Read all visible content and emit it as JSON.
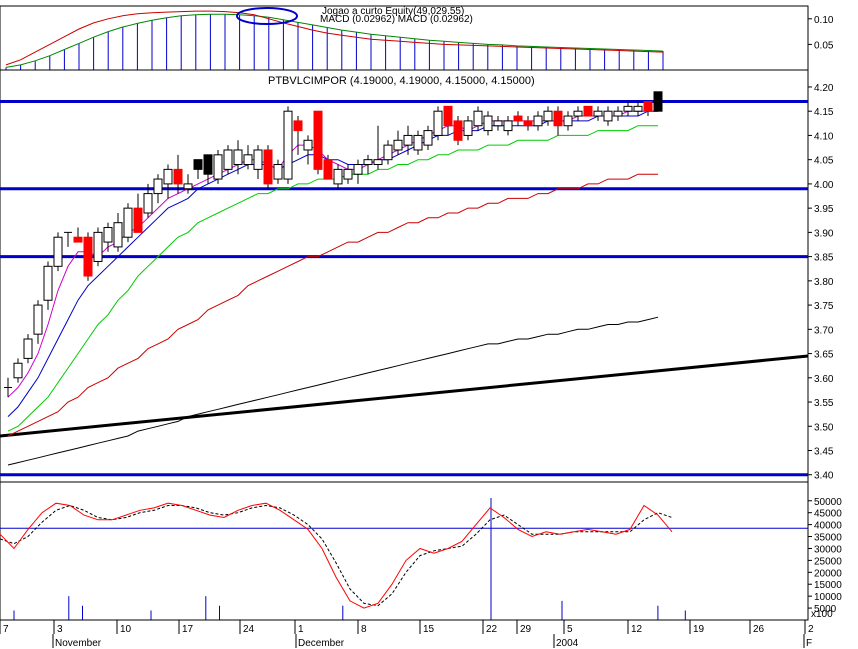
{
  "colors": {
    "background": "#ffffff",
    "frame": "#000000",
    "support_lines": "#0000cc",
    "bull_candle_fill": "#ffffff",
    "bear_candle_fill": "#ff0000",
    "black_candle_fill": "#000000",
    "ma_magenta": "#cc00cc",
    "ma_blue": "#0000cc",
    "ma_green": "#00cc00",
    "ma_red": "#cc0000",
    "ma_black": "#000000",
    "macd_red": "#cc0000",
    "macd_green": "#008800",
    "macd_hist": "#0000cc",
    "stoch_red": "#ff0000",
    "stoch_dash": "#000000",
    "volume": "#0000cc",
    "ellipse": "#0000cc"
  },
  "chart_data": [
    {
      "type": "bar",
      "panel": "macd",
      "title": "MACD (0.02962) MACD (0.02962)",
      "overlay_title": "Jogao a curto Equity(49,029.55)",
      "ylim": [
        0.0,
        0.125
      ],
      "yticks": [
        "0.10",
        "0.05"
      ],
      "ytick_values": [
        0.1,
        0.05
      ],
      "line_red": [
        0.01,
        0.02,
        0.035,
        0.05,
        0.065,
        0.08,
        0.092,
        0.1,
        0.106,
        0.11,
        0.112,
        0.113,
        0.114,
        0.115,
        0.115,
        0.114,
        0.112,
        0.108,
        0.1,
        0.092,
        0.085,
        0.078,
        0.072,
        0.068,
        0.064,
        0.06,
        0.058,
        0.056,
        0.054,
        0.052,
        0.05,
        0.049,
        0.048,
        0.047,
        0.046,
        0.045,
        0.044,
        0.043,
        0.042,
        0.041,
        0.04,
        0.039,
        0.038,
        0.037,
        0.036,
        0.035
      ],
      "line_green": [
        0.005,
        0.01,
        0.018,
        0.028,
        0.04,
        0.052,
        0.064,
        0.075,
        0.084,
        0.091,
        0.097,
        0.102,
        0.106,
        0.108,
        0.109,
        0.109,
        0.108,
        0.106,
        0.103,
        0.098,
        0.093,
        0.088,
        0.083,
        0.078,
        0.074,
        0.07,
        0.067,
        0.064,
        0.061,
        0.058,
        0.056,
        0.054,
        0.052,
        0.05,
        0.049,
        0.047,
        0.046,
        0.045,
        0.044,
        0.043,
        0.042,
        0.041,
        0.04,
        0.039,
        0.038,
        0.037
      ],
      "histogram": [
        0.005,
        0.01,
        0.018,
        0.028,
        0.04,
        0.052,
        0.064,
        0.075,
        0.084,
        0.091,
        0.097,
        0.102,
        0.106,
        0.108,
        0.109,
        0.109,
        0.108,
        0.106,
        0.103,
        0.098,
        0.093,
        0.088,
        0.083,
        0.078,
        0.074,
        0.07,
        0.067,
        0.064,
        0.061,
        0.058,
        0.056,
        0.054,
        0.052,
        0.05,
        0.049,
        0.047,
        0.046,
        0.045,
        0.044,
        0.043,
        0.042,
        0.041,
        0.04,
        0.039,
        0.038,
        0.037
      ]
    },
    {
      "type": "candlestick",
      "panel": "price",
      "title": "PTBVLCIMPOR (4.19000, 4.19000, 4.15000, 4.15000)",
      "ylim": [
        3.385,
        4.235
      ],
      "yticks": [
        "4.20",
        "4.15",
        "4.10",
        "4.05",
        "4.00",
        "3.95",
        "3.90",
        "3.85",
        "3.80",
        "3.75",
        "3.70",
        "3.65",
        "3.60",
        "3.55",
        "3.50",
        "3.45",
        "3.40"
      ],
      "ytick_values": [
        4.2,
        4.15,
        4.1,
        4.05,
        4.0,
        3.95,
        3.9,
        3.85,
        3.8,
        3.75,
        3.7,
        3.65,
        3.6,
        3.55,
        3.5,
        3.45,
        3.4
      ],
      "support_levels": [
        4.17,
        3.99,
        3.85,
        3.4
      ],
      "trendline": {
        "start": 3.48,
        "end": 3.645
      },
      "candles": [
        {
          "o": 3.58,
          "h": 3.6,
          "l": 3.56,
          "c": 3.58,
          "k": "cross"
        },
        {
          "o": 3.6,
          "h": 3.64,
          "l": 3.59,
          "c": 3.63,
          "k": "up"
        },
        {
          "o": 3.64,
          "h": 3.69,
          "l": 3.63,
          "c": 3.68,
          "k": "up"
        },
        {
          "o": 3.69,
          "h": 3.76,
          "l": 3.67,
          "c": 3.75,
          "k": "up"
        },
        {
          "o": 3.76,
          "h": 3.84,
          "l": 3.74,
          "c": 3.83,
          "k": "up"
        },
        {
          "o": 3.83,
          "h": 3.9,
          "l": 3.82,
          "c": 3.89,
          "k": "up"
        },
        {
          "o": 3.9,
          "h": 3.9,
          "l": 3.87,
          "c": 3.9,
          "k": "cross"
        },
        {
          "o": 3.89,
          "h": 3.91,
          "l": 3.88,
          "c": 3.88,
          "k": "down"
        },
        {
          "o": 3.89,
          "h": 3.9,
          "l": 3.8,
          "c": 3.81,
          "k": "down"
        },
        {
          "o": 3.84,
          "h": 3.91,
          "l": 3.83,
          "c": 3.9,
          "k": "up"
        },
        {
          "o": 3.88,
          "h": 3.92,
          "l": 3.86,
          "c": 3.91,
          "k": "up"
        },
        {
          "o": 3.87,
          "h": 3.94,
          "l": 3.86,
          "c": 3.92,
          "k": "up"
        },
        {
          "o": 3.89,
          "h": 3.96,
          "l": 3.88,
          "c": 3.95,
          "k": "up"
        },
        {
          "o": 3.95,
          "h": 3.98,
          "l": 3.9,
          "c": 3.9,
          "k": "down"
        },
        {
          "o": 3.94,
          "h": 4.0,
          "l": 3.93,
          "c": 3.98,
          "k": "up"
        },
        {
          "o": 3.98,
          "h": 4.02,
          "l": 3.96,
          "c": 4.01,
          "k": "up"
        },
        {
          "o": 4.0,
          "h": 4.04,
          "l": 3.97,
          "c": 4.03,
          "k": "up"
        },
        {
          "o": 4.03,
          "h": 4.06,
          "l": 3.98,
          "c": 4.0,
          "k": "down"
        },
        {
          "o": 3.99,
          "h": 4.02,
          "l": 3.98,
          "c": 4.0,
          "k": "up"
        },
        {
          "o": 4.03,
          "h": 4.05,
          "l": 4.01,
          "c": 4.05,
          "k": "black"
        },
        {
          "o": 4.02,
          "h": 4.06,
          "l": 4.0,
          "c": 4.06,
          "k": "black"
        },
        {
          "o": 4.01,
          "h": 4.07,
          "l": 4.0,
          "c": 4.06,
          "k": "up"
        },
        {
          "o": 4.03,
          "h": 4.08,
          "l": 4.02,
          "c": 4.07,
          "k": "up"
        },
        {
          "o": 4.04,
          "h": 4.09,
          "l": 4.02,
          "c": 4.07,
          "k": "up"
        },
        {
          "o": 4.04,
          "h": 4.08,
          "l": 4.03,
          "c": 4.06,
          "k": "up"
        },
        {
          "o": 4.03,
          "h": 4.08,
          "l": 4.01,
          "c": 4.07,
          "k": "up"
        },
        {
          "o": 4.07,
          "h": 4.08,
          "l": 3.99,
          "c": 4.0,
          "k": "down"
        },
        {
          "o": 4.01,
          "h": 4.05,
          "l": 4.0,
          "c": 4.04,
          "k": "up"
        },
        {
          "o": 4.01,
          "h": 4.16,
          "l": 4.0,
          "c": 4.15,
          "k": "up"
        },
        {
          "o": 4.13,
          "h": 4.14,
          "l": 4.06,
          "c": 4.11,
          "k": "down"
        },
        {
          "o": 4.09,
          "h": 4.1,
          "l": 4.04,
          "c": 4.07,
          "k": "up"
        },
        {
          "o": 4.15,
          "h": 4.15,
          "l": 4.02,
          "c": 4.03,
          "k": "down"
        },
        {
          "o": 4.05,
          "h": 4.06,
          "l": 4.01,
          "c": 4.01,
          "k": "down"
        },
        {
          "o": 4.0,
          "h": 4.04,
          "l": 3.99,
          "c": 4.03,
          "k": "up"
        },
        {
          "o": 4.01,
          "h": 4.04,
          "l": 4.0,
          "c": 4.03,
          "k": "up"
        },
        {
          "o": 4.02,
          "h": 4.05,
          "l": 4.0,
          "c": 4.04,
          "k": "up"
        },
        {
          "o": 4.04,
          "h": 4.06,
          "l": 4.02,
          "c": 4.05,
          "k": "up"
        },
        {
          "o": 4.04,
          "h": 4.12,
          "l": 4.03,
          "c": 4.05,
          "k": "up"
        },
        {
          "o": 4.05,
          "h": 4.09,
          "l": 4.04,
          "c": 4.08,
          "k": "up"
        },
        {
          "o": 4.07,
          "h": 4.11,
          "l": 4.06,
          "c": 4.09,
          "k": "up"
        },
        {
          "o": 4.08,
          "h": 4.12,
          "l": 4.06,
          "c": 4.1,
          "k": "up"
        },
        {
          "o": 4.07,
          "h": 4.11,
          "l": 4.06,
          "c": 4.1,
          "k": "up"
        },
        {
          "o": 4.08,
          "h": 4.12,
          "l": 4.07,
          "c": 4.11,
          "k": "up"
        },
        {
          "o": 4.1,
          "h": 4.16,
          "l": 4.09,
          "c": 4.15,
          "k": "up"
        },
        {
          "o": 4.16,
          "h": 4.16,
          "l": 4.1,
          "c": 4.12,
          "k": "down"
        },
        {
          "o": 4.13,
          "h": 4.14,
          "l": 4.08,
          "c": 4.09,
          "k": "down"
        },
        {
          "o": 4.1,
          "h": 4.14,
          "l": 4.09,
          "c": 4.13,
          "k": "up"
        },
        {
          "o": 4.12,
          "h": 4.16,
          "l": 4.11,
          "c": 4.15,
          "k": "up"
        },
        {
          "o": 4.11,
          "h": 4.15,
          "l": 4.1,
          "c": 4.14,
          "k": "up"
        },
        {
          "o": 4.12,
          "h": 4.14,
          "l": 4.11,
          "c": 4.13,
          "k": "up"
        },
        {
          "o": 4.11,
          "h": 4.14,
          "l": 4.1,
          "c": 4.13,
          "k": "up"
        },
        {
          "o": 4.14,
          "h": 4.15,
          "l": 4.12,
          "c": 4.13,
          "k": "down"
        },
        {
          "o": 4.13,
          "h": 4.14,
          "l": 4.11,
          "c": 4.12,
          "k": "down"
        },
        {
          "o": 4.12,
          "h": 4.15,
          "l": 4.11,
          "c": 4.14,
          "k": "up"
        },
        {
          "o": 4.13,
          "h": 4.16,
          "l": 4.12,
          "c": 4.15,
          "k": "up"
        },
        {
          "o": 4.15,
          "h": 4.16,
          "l": 4.1,
          "c": 4.12,
          "k": "down"
        },
        {
          "o": 4.12,
          "h": 4.15,
          "l": 4.11,
          "c": 4.14,
          "k": "up"
        },
        {
          "o": 4.14,
          "h": 4.16,
          "l": 4.13,
          "c": 4.15,
          "k": "up"
        },
        {
          "o": 4.16,
          "h": 4.16,
          "l": 4.14,
          "c": 4.14,
          "k": "down"
        },
        {
          "o": 4.14,
          "h": 4.16,
          "l": 4.13,
          "c": 4.15,
          "k": "up"
        },
        {
          "o": 4.13,
          "h": 4.16,
          "l": 4.12,
          "c": 4.15,
          "k": "up"
        },
        {
          "o": 4.14,
          "h": 4.16,
          "l": 4.13,
          "c": 4.15,
          "k": "up"
        },
        {
          "o": 4.15,
          "h": 4.17,
          "l": 4.14,
          "c": 4.16,
          "k": "up"
        },
        {
          "o": 4.15,
          "h": 4.17,
          "l": 4.14,
          "c": 4.16,
          "k": "up"
        },
        {
          "o": 4.17,
          "h": 4.17,
          "l": 4.14,
          "c": 4.15,
          "k": "down"
        },
        {
          "o": 4.19,
          "h": 4.19,
          "l": 4.15,
          "c": 4.15,
          "k": "black"
        }
      ],
      "ma_magenta": [
        3.56,
        3.58,
        3.61,
        3.65,
        3.71,
        3.78,
        3.83,
        3.86,
        3.86,
        3.85,
        3.87,
        3.88,
        3.9,
        3.91,
        3.93,
        3.95,
        3.97,
        3.98,
        3.99,
        4.0,
        4.01,
        4.02,
        4.03,
        4.04,
        4.05,
        4.05,
        4.04,
        4.03,
        4.06,
        4.08,
        4.08,
        4.07,
        4.05,
        4.04,
        4.03,
        4.03,
        4.04,
        4.05,
        4.06,
        4.07,
        4.08,
        4.09,
        4.1,
        4.11,
        4.12,
        4.12,
        4.11,
        4.12,
        4.13,
        4.13,
        4.13,
        4.13,
        4.13,
        4.13,
        4.13,
        4.13,
        4.13,
        4.14,
        4.14,
        4.14,
        4.14,
        4.14,
        4.15,
        4.15,
        4.15,
        4.15
      ],
      "ma_blue": [
        3.52,
        3.54,
        3.57,
        3.6,
        3.64,
        3.68,
        3.72,
        3.76,
        3.79,
        3.81,
        3.83,
        3.85,
        3.87,
        3.89,
        3.91,
        3.93,
        3.95,
        3.96,
        3.97,
        3.99,
        4.0,
        4.01,
        4.02,
        4.03,
        4.04,
        4.04,
        4.04,
        4.03,
        4.04,
        4.05,
        4.06,
        4.06,
        4.05,
        4.05,
        4.04,
        4.04,
        4.04,
        4.05,
        4.05,
        4.06,
        4.07,
        4.08,
        4.09,
        4.1,
        4.1,
        4.11,
        4.11,
        4.11,
        4.12,
        4.12,
        4.12,
        4.12,
        4.12,
        4.12,
        4.13,
        4.13,
        4.13,
        4.13,
        4.13,
        4.14,
        4.14,
        4.14,
        4.14,
        4.14,
        4.15,
        4.15
      ],
      "ma_green": [
        3.49,
        3.5,
        3.52,
        3.54,
        3.56,
        3.59,
        3.62,
        3.65,
        3.68,
        3.71,
        3.73,
        3.76,
        3.78,
        3.81,
        3.83,
        3.85,
        3.87,
        3.89,
        3.9,
        3.92,
        3.93,
        3.94,
        3.95,
        3.96,
        3.97,
        3.98,
        3.98,
        3.99,
        3.99,
        4.0,
        4.0,
        4.01,
        4.01,
        4.01,
        4.02,
        4.02,
        4.02,
        4.03,
        4.03,
        4.04,
        4.04,
        4.05,
        4.05,
        4.06,
        4.06,
        4.07,
        4.07,
        4.07,
        4.08,
        4.08,
        4.08,
        4.09,
        4.09,
        4.09,
        4.09,
        4.1,
        4.1,
        4.1,
        4.1,
        4.11,
        4.11,
        4.11,
        4.11,
        4.12,
        4.12,
        4.12
      ],
      "ma_red": [
        3.48,
        3.49,
        3.5,
        3.51,
        3.52,
        3.53,
        3.55,
        3.56,
        3.58,
        3.59,
        3.6,
        3.62,
        3.63,
        3.64,
        3.66,
        3.67,
        3.68,
        3.7,
        3.71,
        3.72,
        3.74,
        3.75,
        3.76,
        3.77,
        3.79,
        3.8,
        3.81,
        3.82,
        3.83,
        3.84,
        3.85,
        3.85,
        3.86,
        3.87,
        3.88,
        3.88,
        3.89,
        3.9,
        3.9,
        3.91,
        3.92,
        3.92,
        3.93,
        3.93,
        3.94,
        3.94,
        3.95,
        3.95,
        3.96,
        3.96,
        3.97,
        3.97,
        3.97,
        3.98,
        3.98,
        3.99,
        3.99,
        3.99,
        4.0,
        4.0,
        4.01,
        4.01,
        4.01,
        4.02,
        4.02,
        4.02
      ],
      "ma_black": [
        3.42,
        3.425,
        3.43,
        3.435,
        3.44,
        3.445,
        3.45,
        3.455,
        3.46,
        3.465,
        3.47,
        3.475,
        3.48,
        3.49,
        3.495,
        3.5,
        3.505,
        3.51,
        3.52,
        3.525,
        3.53,
        3.535,
        3.54,
        3.545,
        3.55,
        3.555,
        3.56,
        3.565,
        3.57,
        3.575,
        3.58,
        3.585,
        3.59,
        3.595,
        3.6,
        3.605,
        3.61,
        3.615,
        3.62,
        3.625,
        3.63,
        3.635,
        3.64,
        3.645,
        3.65,
        3.655,
        3.66,
        3.665,
        3.67,
        3.67,
        3.675,
        3.68,
        3.68,
        3.685,
        3.69,
        3.69,
        3.695,
        3.7,
        3.7,
        3.705,
        3.71,
        3.71,
        3.715,
        3.715,
        3.72,
        3.725
      ]
    },
    {
      "type": "line",
      "panel": "oscillator",
      "ylim": [
        0,
        52000
      ],
      "yticks": [
        "50000",
        "45000",
        "40000",
        "35000",
        "30000",
        "25000",
        "20000",
        "15000",
        "10000",
        "5000"
      ],
      "ytick_values": [
        50000,
        45000,
        40000,
        35000,
        30000,
        25000,
        20000,
        15000,
        10000,
        5000
      ],
      "ylabel_unit": "x100",
      "reference_level": 38500,
      "series_red": [
        36000,
        30000,
        38000,
        45000,
        49000,
        48000,
        44000,
        42000,
        42000,
        44000,
        46000,
        47000,
        49000,
        48000,
        46000,
        44000,
        43000,
        46000,
        48000,
        49000,
        46000,
        42000,
        38000,
        30000,
        18000,
        8000,
        5000,
        7000,
        15000,
        25000,
        30000,
        28000,
        30000,
        33000,
        40000,
        47000,
        43000,
        38000,
        35000,
        37000,
        36000,
        37000,
        38000,
        37000,
        36000,
        38000,
        48000,
        44000,
        37000
      ],
      "series_dash": [
        34000,
        32000,
        35000,
        41000,
        46000,
        48000,
        46000,
        43000,
        42000,
        43000,
        45000,
        46000,
        48000,
        48000,
        47000,
        45000,
        44000,
        45000,
        47000,
        48000,
        47000,
        44000,
        40000,
        34000,
        24000,
        13000,
        7000,
        6000,
        11000,
        20000,
        27000,
        29000,
        30000,
        31000,
        36000,
        42000,
        44000,
        40000,
        36000,
        36000,
        36000,
        37000,
        37000,
        37000,
        37000,
        37000,
        42000,
        45000,
        43000
      ],
      "volume": [
        2000,
        0,
        0,
        0,
        5000,
        3000,
        0,
        0,
        0,
        0,
        2000,
        0,
        0,
        0,
        5000,
        3000,
        0,
        0,
        0,
        0,
        0,
        0,
        0,
        0,
        3000,
        0,
        0,
        0,
        0,
        0,
        0,
        0,
        0,
        0,
        0,
        0,
        0,
        0,
        0,
        0,
        4000,
        0,
        0,
        0,
        0,
        0,
        0,
        3000,
        0,
        2000,
        0
      ]
    }
  ],
  "x_axis": {
    "day_ticks": [
      "7",
      "3",
      "10",
      "17",
      "24",
      "1",
      "8",
      "15",
      "22",
      "29",
      "5",
      "12",
      "19",
      "26",
      "2"
    ],
    "month_labels": [
      "November",
      "December",
      "2004",
      "F"
    ]
  }
}
